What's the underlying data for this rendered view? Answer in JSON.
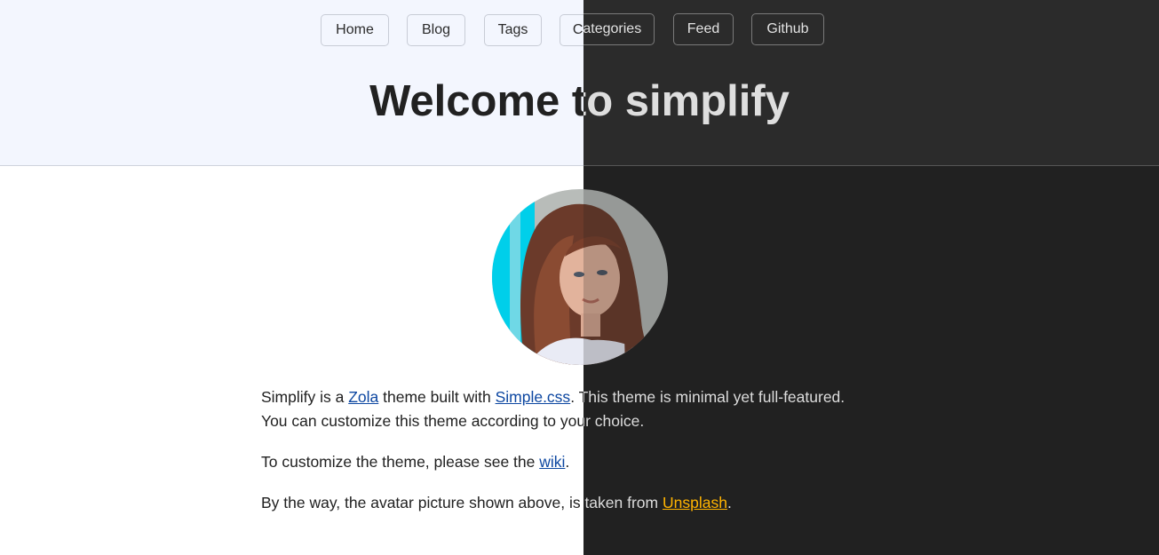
{
  "nav": {
    "items": [
      "Home",
      "Blog",
      "Tags",
      "Categories",
      "Feed",
      "Github"
    ]
  },
  "page_title": "Welcome to simplify",
  "intro": {
    "prefix": "Simplify is a ",
    "zola_link": "Zola",
    "middle": " theme built with ",
    "simplecss_link": "Simple.css",
    "suffix": ". This theme is minimal yet full-featured."
  },
  "customize_line": "You can customize this theme according to your choice.",
  "wiki": {
    "prefix": "To customize the theme, please see the ",
    "link": "wiki",
    "suffix": "."
  },
  "credit": {
    "prefix": "By the way, the avatar picture shown above, is taken from ",
    "link": "Unsplash",
    "suffix": "."
  },
  "avatar": {
    "icon": "portrait-photo"
  },
  "colors": {
    "light_bg": "#ffffff",
    "light_header_bg": "#f3f6fe",
    "dark_bg": "#212121",
    "dark_header_bg": "#2b2b2b",
    "light_link": "#0d47a1",
    "dark_link": "#ffb300"
  }
}
